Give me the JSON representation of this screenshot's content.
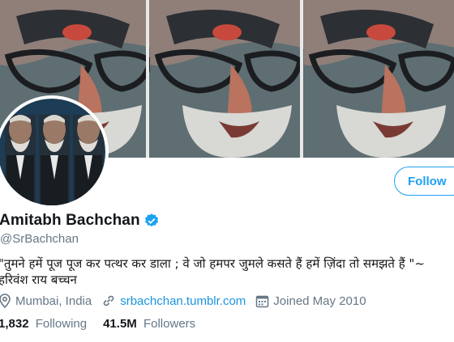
{
  "profile": {
    "name": "Amitabh Bachchan",
    "handle": "@SrBachchan",
    "bio_line1": "\"तुमने हमें पूज पूज कर पत्थर कर डाला ; वे जो हमपर जुमले कसते हैं हमें ज़िंदा तो समझते हैं \"~",
    "bio_line2": "हरिवंश राय  बच्चन",
    "location": "Mumbai, India",
    "website": "srbachchan.tumblr.com",
    "joined": "Joined May 2010",
    "following_count": "1,832",
    "following_label": "Following",
    "followers_count": "41.5M",
    "followers_label": "Followers"
  },
  "actions": {
    "follow_label": "Follow"
  },
  "icons": {
    "verified": "verified-badge-icon",
    "location": "location-pin-icon",
    "link": "link-icon",
    "calendar": "calendar-icon"
  },
  "colors": {
    "accent": "#1da1f2",
    "link": "#1b95e0",
    "muted": "#657786",
    "text": "#14171a"
  }
}
